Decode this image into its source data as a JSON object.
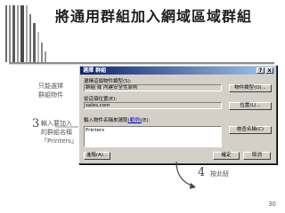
{
  "slide": {
    "title": "將通用群組加入網域區域群組",
    "page_number": "30"
  },
  "annotations": {
    "left_note": "只能選擇\n群組物件",
    "step3_number": "3",
    "step3_text": "輸入要加入\n的群組名稱\n「Printers」",
    "step4_number": "4",
    "step4_text": "按此鈕"
  },
  "dialog": {
    "title": "選擇 群組",
    "help_label": "?",
    "close_label": "x",
    "object_type_label": "選擇這個物件類型(S):",
    "object_type_value": "群組 或 內建安全性原則",
    "object_type_button": "物件類型(O)...",
    "location_label": "從這個位置(E):",
    "location_value": "sales.com",
    "location_button": "位置(L)...",
    "enter_names_prefix": "輸入物件名稱來選取",
    "enter_names_link": "(範例)",
    "enter_names_suffix": "(E):",
    "names_value": "Printers",
    "check_names_button": "檢查名稱(C)",
    "advanced_button": "進階(A)...",
    "ok_button": "確定",
    "cancel_button": "取消"
  }
}
